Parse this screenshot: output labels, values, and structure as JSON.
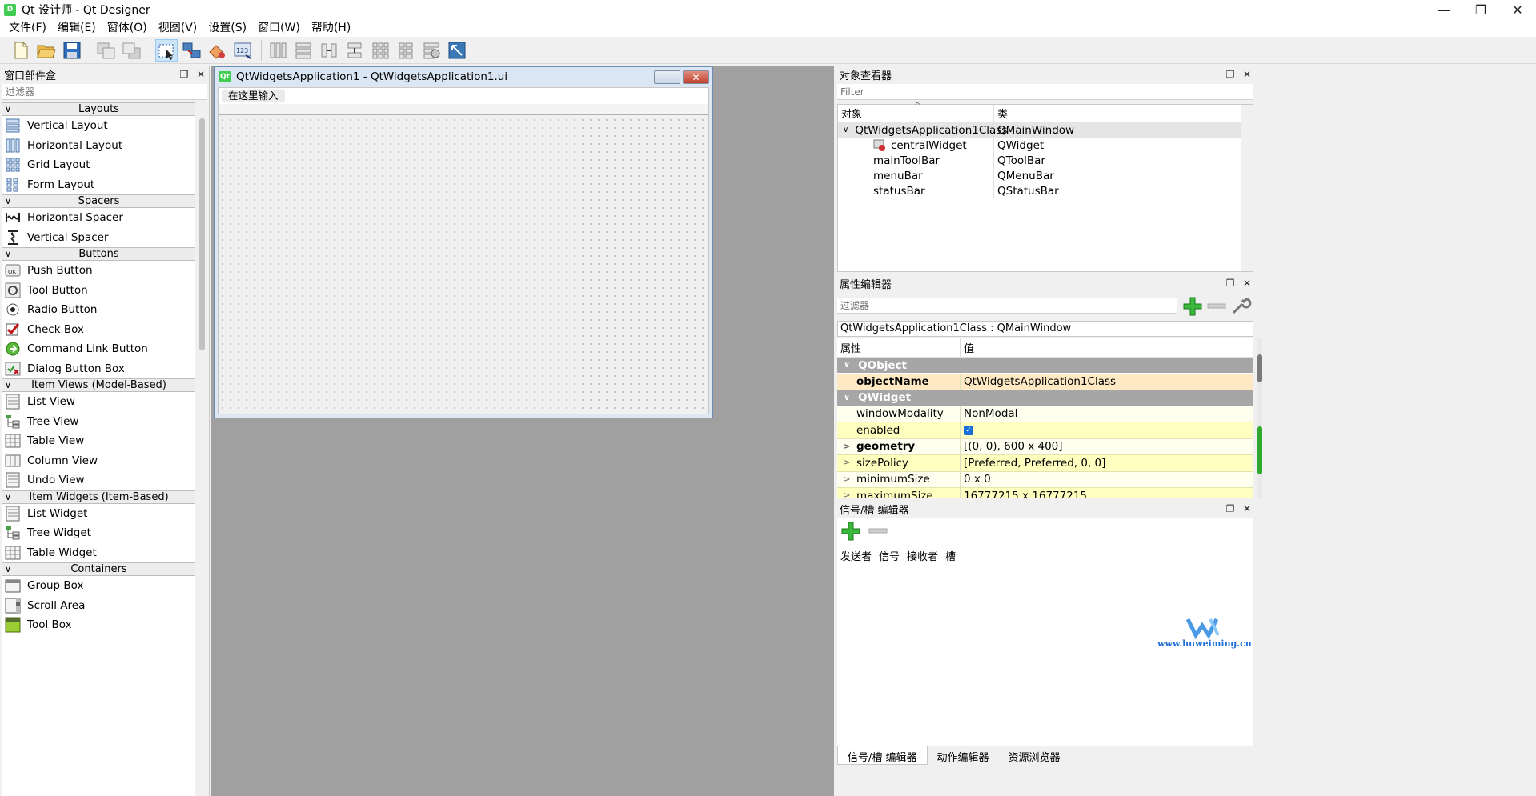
{
  "window": {
    "title": "Qt 设计师 - Qt Designer",
    "app_icon_glyph": "D",
    "minimize": "—",
    "maximize": "❐",
    "close": "✕"
  },
  "menubar": {
    "items": [
      "文件(F)",
      "编辑(E)",
      "窗体(O)",
      "视图(V)",
      "设置(S)",
      "窗口(W)",
      "帮助(H)"
    ]
  },
  "widget_box": {
    "title": "窗口部件盒",
    "filter_placeholder": "过滤器",
    "float_glyph": "❐",
    "close_glyph": "✕",
    "categories": {
      "layouts": {
        "label": "Layouts",
        "items": [
          "Vertical Layout",
          "Horizontal Layout",
          "Grid Layout",
          "Form Layout"
        ]
      },
      "spacers": {
        "label": "Spacers",
        "items": [
          "Horizontal Spacer",
          "Vertical Spacer"
        ]
      },
      "buttons": {
        "label": "Buttons",
        "items": [
          "Push Button",
          "Tool Button",
          "Radio Button",
          "Check Box",
          "Command Link Button",
          "Dialog Button Box"
        ]
      },
      "item_views": {
        "label": "Item Views (Model-Based)",
        "items": [
          "List View",
          "Tree View",
          "Table View",
          "Column View",
          "Undo View"
        ]
      },
      "item_widgets": {
        "label": "Item Widgets (Item-Based)",
        "items": [
          "List Widget",
          "Tree Widget",
          "Table Widget"
        ]
      },
      "containers": {
        "label": "Containers",
        "items": [
          "Group Box",
          "Scroll Area",
          "Tool Box"
        ]
      }
    }
  },
  "form": {
    "title": "QtWidgetsApplication1 - QtWidgetsApplication1.ui",
    "badge": "Qt",
    "menu_placeholder": "在这里输入",
    "min_glyph": "—",
    "close_glyph": "✕"
  },
  "object_inspector": {
    "title": "对象查看器",
    "filter_placeholder": "Filter",
    "col_object": "对象",
    "col_class": "类",
    "rows": [
      {
        "name": "QtWidgetsApplication1Class",
        "cls": "QMainWindow"
      },
      {
        "name": "centralWidget",
        "cls": "QWidget"
      },
      {
        "name": "mainToolBar",
        "cls": "QToolBar"
      },
      {
        "name": "menuBar",
        "cls": "QMenuBar"
      },
      {
        "name": "statusBar",
        "cls": "QStatusBar"
      }
    ]
  },
  "property_editor": {
    "title": "属性编辑器",
    "filter_placeholder": "过滤器",
    "class_line": "QtWidgetsApplication1Class : QMainWindow",
    "col_property": "属性",
    "col_value": "值",
    "groups": {
      "qobject": "QObject",
      "qwidget": "QWidget"
    },
    "rows": [
      {
        "name": "objectName",
        "value": "QtWidgetsApplication1Class"
      },
      {
        "name": "windowModality",
        "value": "NonModal"
      },
      {
        "name": "enabled",
        "value": ""
      },
      {
        "name": "geometry",
        "value": "[(0, 0), 600 x 400]"
      },
      {
        "name": "sizePolicy",
        "value": "[Preferred, Preferred, 0, 0]"
      },
      {
        "name": "minimumSize",
        "value": "0 x 0"
      },
      {
        "name": "maximumSize",
        "value": "16777215 x 16777215"
      }
    ]
  },
  "signal_slot_editor": {
    "title": "信号/槽 编辑器",
    "col_sender": "发送者",
    "col_signal": "信号",
    "col_receiver": "接收者",
    "col_slot": "槽",
    "tabs": [
      "信号/槽 编辑器",
      "动作编辑器",
      "资源浏览器"
    ]
  },
  "watermark": {
    "text": "www.huweiming.cn"
  }
}
